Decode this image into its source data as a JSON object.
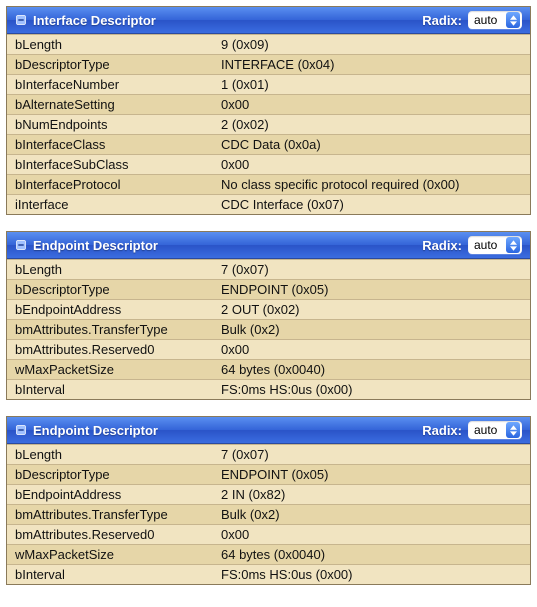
{
  "radix_label": "Radix:",
  "panels": [
    {
      "title": "Interface Descriptor",
      "radix": "auto",
      "rows": [
        {
          "key": "bLength",
          "val": "9 (0x09)"
        },
        {
          "key": "bDescriptorType",
          "val": "INTERFACE (0x04)"
        },
        {
          "key": "bInterfaceNumber",
          "val": "1 (0x01)"
        },
        {
          "key": "bAlternateSetting",
          "val": "0x00"
        },
        {
          "key": "bNumEndpoints",
          "val": "2 (0x02)"
        },
        {
          "key": "bInterfaceClass",
          "val": "CDC Data (0x0a)"
        },
        {
          "key": "bInterfaceSubClass",
          "val": "0x00"
        },
        {
          "key": "bInterfaceProtocol",
          "val": "No class specific protocol required (0x00)"
        },
        {
          "key": "iInterface",
          "val": "CDC Interface (0x07)"
        }
      ]
    },
    {
      "title": "Endpoint Descriptor",
      "radix": "auto",
      "rows": [
        {
          "key": "bLength",
          "val": "7 (0x07)"
        },
        {
          "key": "bDescriptorType",
          "val": "ENDPOINT (0x05)"
        },
        {
          "key": "bEndpointAddress",
          "val": "2 OUT (0x02)"
        },
        {
          "key": "bmAttributes.TransferType",
          "val": "Bulk (0x2)"
        },
        {
          "key": "bmAttributes.Reserved0",
          "val": "0x00"
        },
        {
          "key": "wMaxPacketSize",
          "val": "64 bytes (0x0040)"
        },
        {
          "key": "bInterval",
          "val": "FS:0ms HS:0us (0x00)"
        }
      ]
    },
    {
      "title": "Endpoint Descriptor",
      "radix": "auto",
      "rows": [
        {
          "key": "bLength",
          "val": "7 (0x07)"
        },
        {
          "key": "bDescriptorType",
          "val": "ENDPOINT (0x05)"
        },
        {
          "key": "bEndpointAddress",
          "val": "2 IN (0x82)"
        },
        {
          "key": "bmAttributes.TransferType",
          "val": "Bulk (0x2)"
        },
        {
          "key": "bmAttributes.Reserved0",
          "val": "0x00"
        },
        {
          "key": "wMaxPacketSize",
          "val": "64 bytes (0x0040)"
        },
        {
          "key": "bInterval",
          "val": "FS:0ms HS:0us (0x00)"
        }
      ]
    }
  ]
}
